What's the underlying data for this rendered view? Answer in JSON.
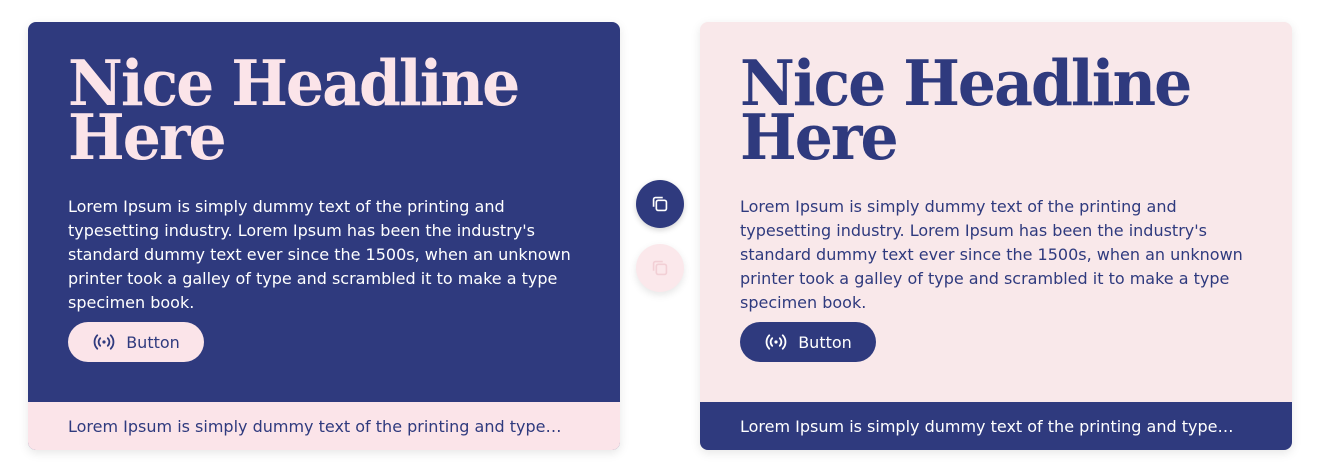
{
  "cards": [
    {
      "variant": "dark",
      "headline": "Nice Headline Here",
      "body": "Lorem Ipsum is simply dummy text of the printing and typesetting industry. Lorem Ipsum has been the industry's standard dummy text ever since the 1500s, when an unknown printer took a galley of type and scrambled it to make a type specimen book.",
      "button_label": "Button",
      "button_icon": "broadcast-icon",
      "footer": "Lorem Ipsum is simply dummy text of the printing and typesetting..."
    },
    {
      "variant": "light",
      "headline": "Nice Headline Here",
      "body": "Lorem Ipsum is simply dummy text of the printing and typesetting industry. Lorem Ipsum has been the industry's standard dummy text ever since the 1500s, when an unknown printer took a galley of type and scrambled it to make a type specimen book.",
      "button_label": "Button",
      "button_icon": "broadcast-icon",
      "footer": "Lorem Ipsum is simply dummy text of the printing and typesetting..."
    }
  ],
  "floating_actions": [
    {
      "icon": "copy-icon",
      "state": "active"
    },
    {
      "icon": "copy-icon",
      "state": "inactive"
    }
  ],
  "colors": {
    "navy": "#2f3a7e",
    "pink": "#fbe4e9",
    "light_card_bg": "#f9e8ea",
    "white": "#ffffff"
  }
}
